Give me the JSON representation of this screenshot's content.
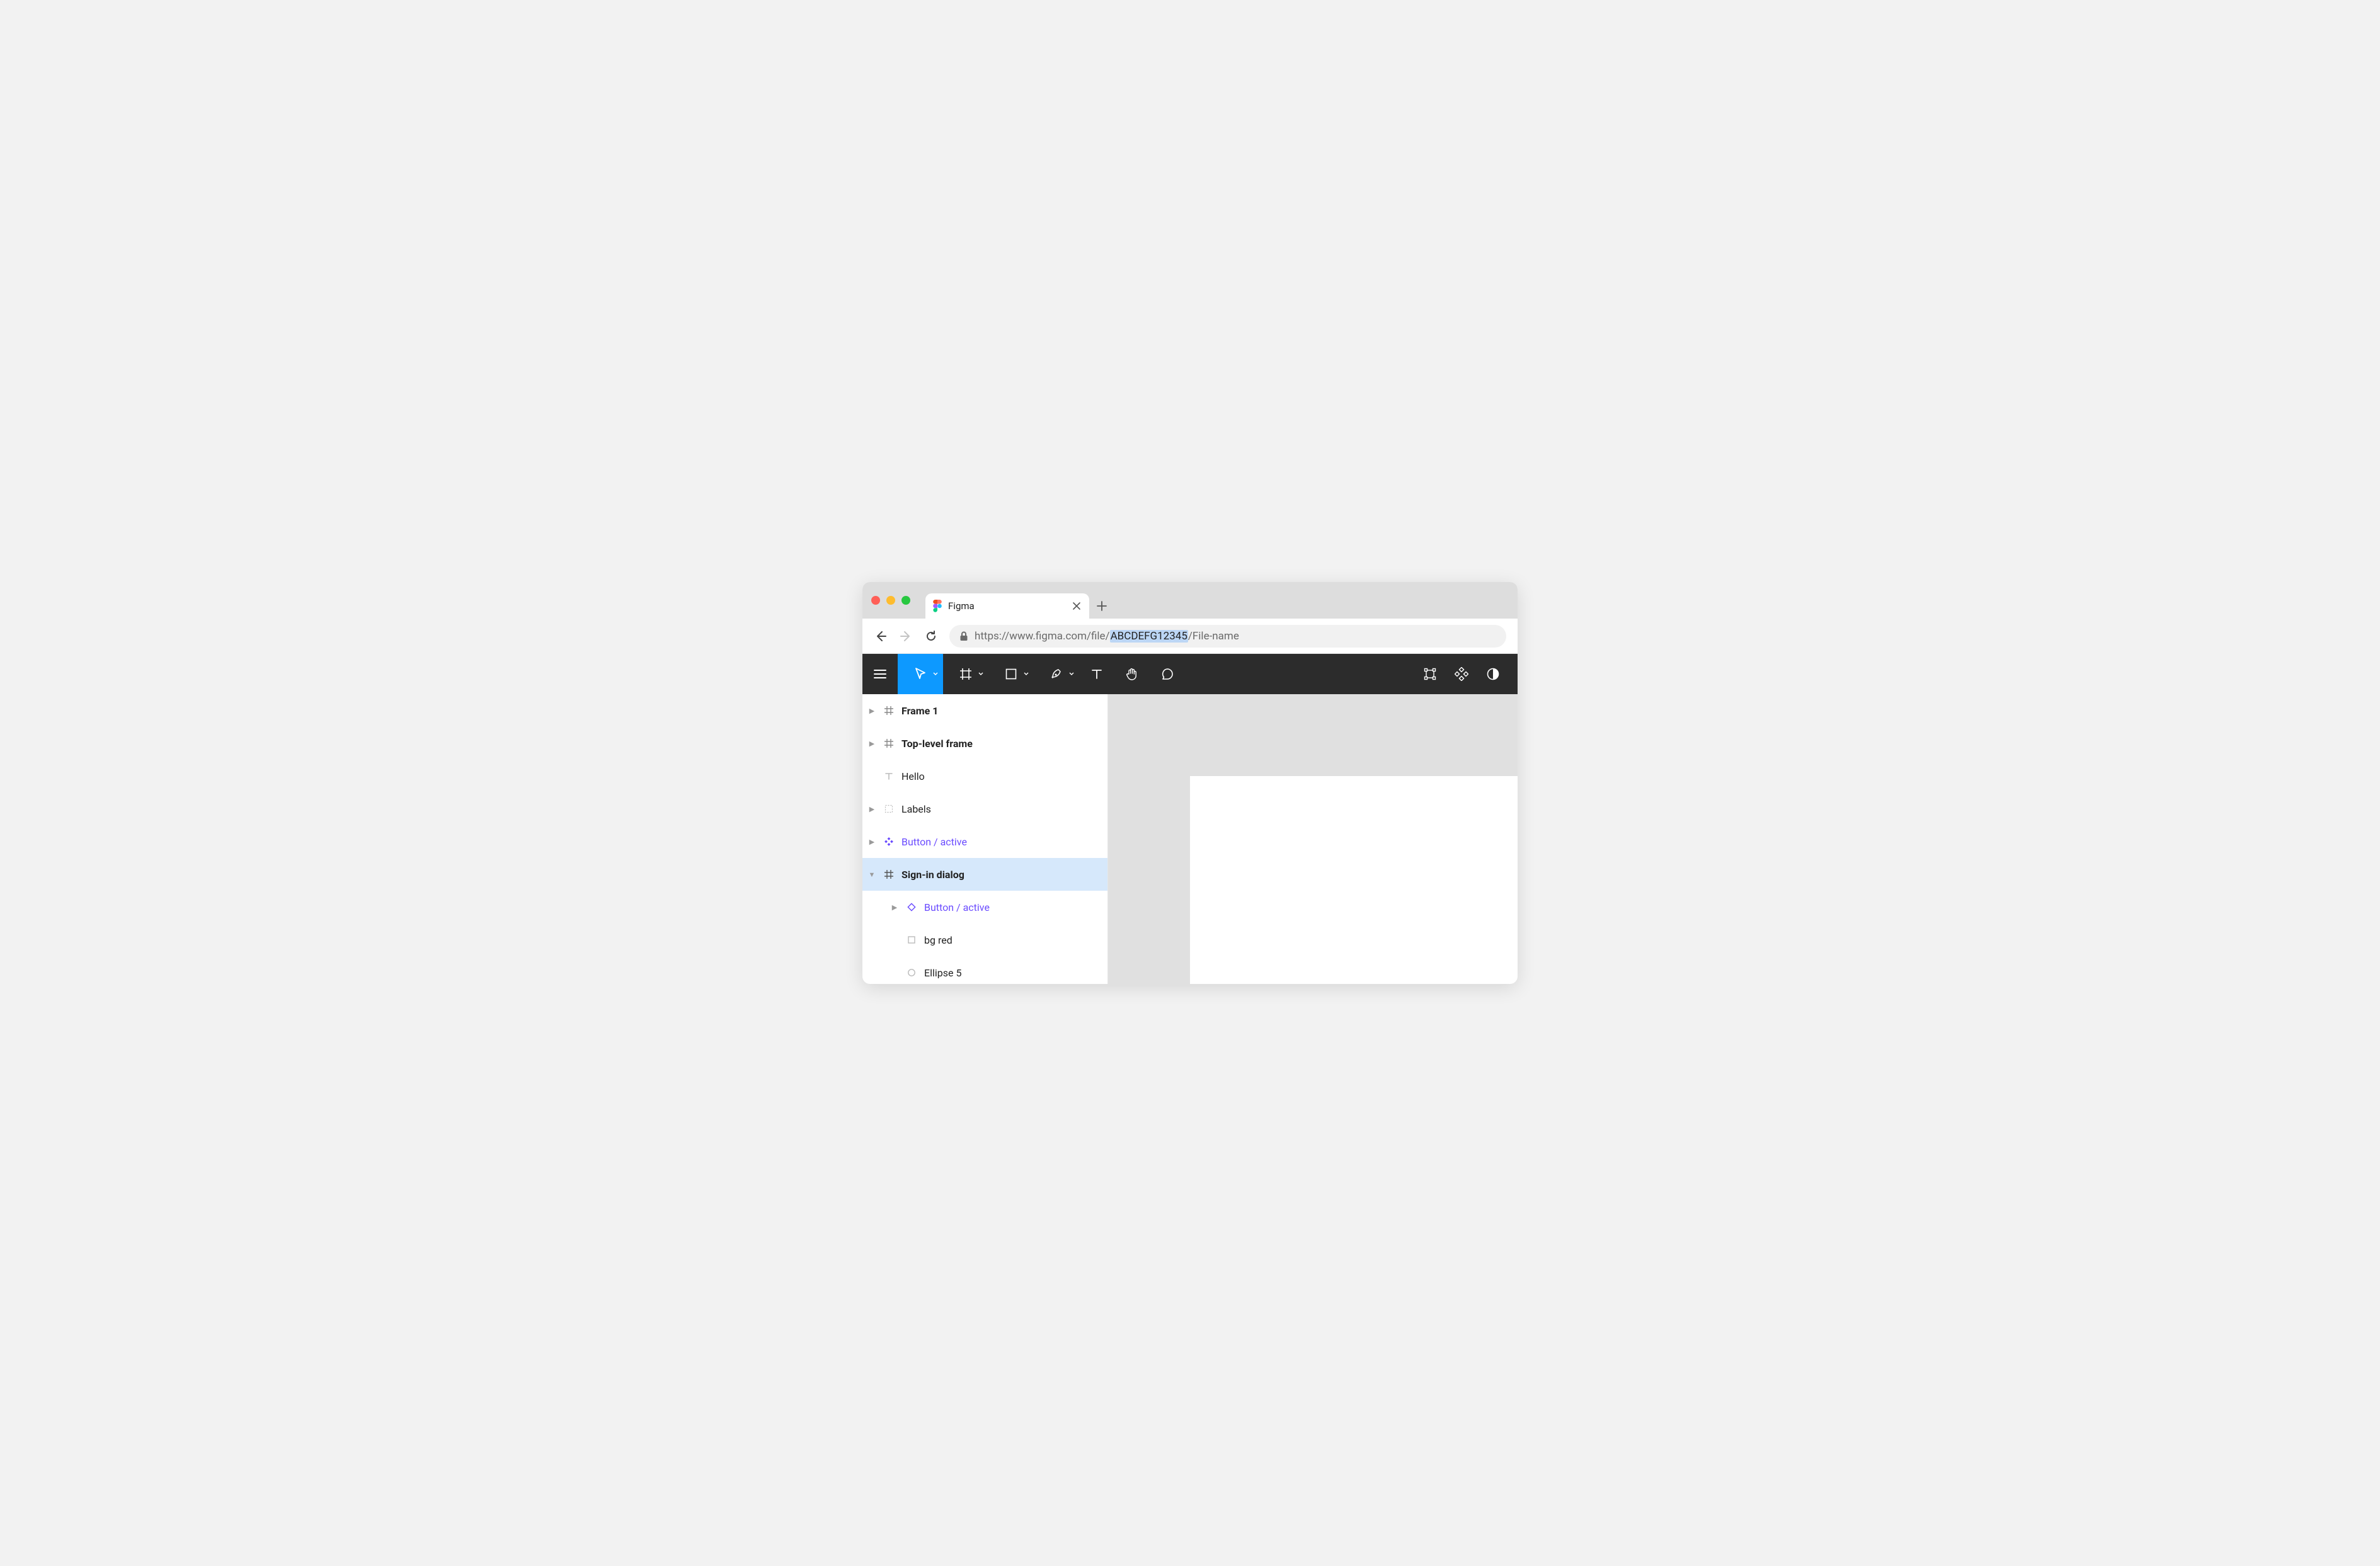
{
  "browser": {
    "tab_title": "Figma",
    "url_prefix": "https://www.figma.com/file/",
    "url_selected_segment": "ABCDEFG12345",
    "url_suffix": "/File-name"
  },
  "toolbar": {
    "menu": "menu-icon",
    "move": "move-tool",
    "frame": "frame-tool",
    "rectangle": "rectangle-tool",
    "pen": "pen-tool",
    "text": "text-tool",
    "hand": "hand-tool",
    "comment": "comment-tool",
    "right_a": "edit-object-icon",
    "right_b": "components-icon",
    "right_c": "mask-icon"
  },
  "layers": [
    {
      "label": "Frame 1",
      "icon": "frame-icon",
      "bold": true,
      "caret": "right"
    },
    {
      "label": "Top-level frame",
      "icon": "frame-icon",
      "bold": true,
      "caret": "right"
    },
    {
      "label": "Hello",
      "icon": "text-icon",
      "bold": false,
      "caret": ""
    },
    {
      "label": "Labels",
      "icon": "group-icon",
      "bold": false,
      "caret": "right"
    },
    {
      "label": "Button / active",
      "icon": "component-icon",
      "bold": false,
      "caret": "right",
      "purple": true
    },
    {
      "label": "Sign-in dialog",
      "icon": "frame-icon",
      "bold": true,
      "caret": "down",
      "selected": true
    },
    {
      "label": "Button / active",
      "icon": "instance-icon",
      "bold": false,
      "caret": "right",
      "purple": true,
      "child": 1
    },
    {
      "label": "bg red",
      "icon": "rect-icon",
      "bold": false,
      "caret": "",
      "child": 2
    },
    {
      "label": "Ellipse 5",
      "icon": "ellipse-icon",
      "bold": false,
      "caret": "",
      "child": 2
    }
  ]
}
